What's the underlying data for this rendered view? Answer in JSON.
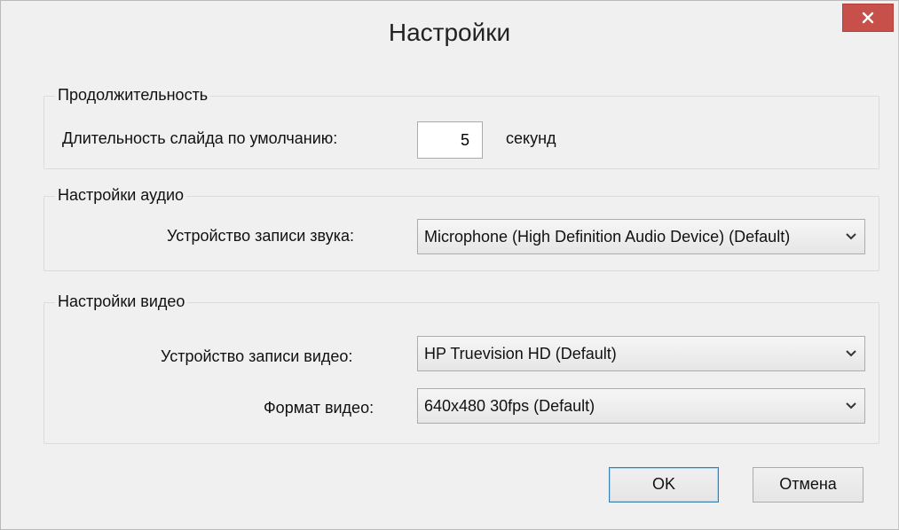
{
  "window": {
    "title": "Настройки"
  },
  "duration": {
    "group_title": "Продолжительность",
    "default_slide_label": "Длительность слайда по умолчанию:",
    "default_slide_value": "5",
    "unit_label": "секунд"
  },
  "audio": {
    "group_title": "Настройки аудио",
    "device_label": "Устройство записи звука:",
    "device_value": "Microphone (High Definition Audio Device) (Default)"
  },
  "video": {
    "group_title": "Настройки видео",
    "device_label": "Устройство записи видео:",
    "device_value": "HP Truevision HD (Default)",
    "format_label": "Формат видео:",
    "format_value": "640x480 30fps (Default)"
  },
  "buttons": {
    "ok": "OK",
    "cancel": "Отмена"
  },
  "colors": {
    "close_button": "#c7504b",
    "default_button_border": "#3c7fb1",
    "dialog_bg": "#f0f0f0"
  },
  "icons": {
    "close": "close-icon",
    "dropdown": "chevron-down-icon"
  }
}
